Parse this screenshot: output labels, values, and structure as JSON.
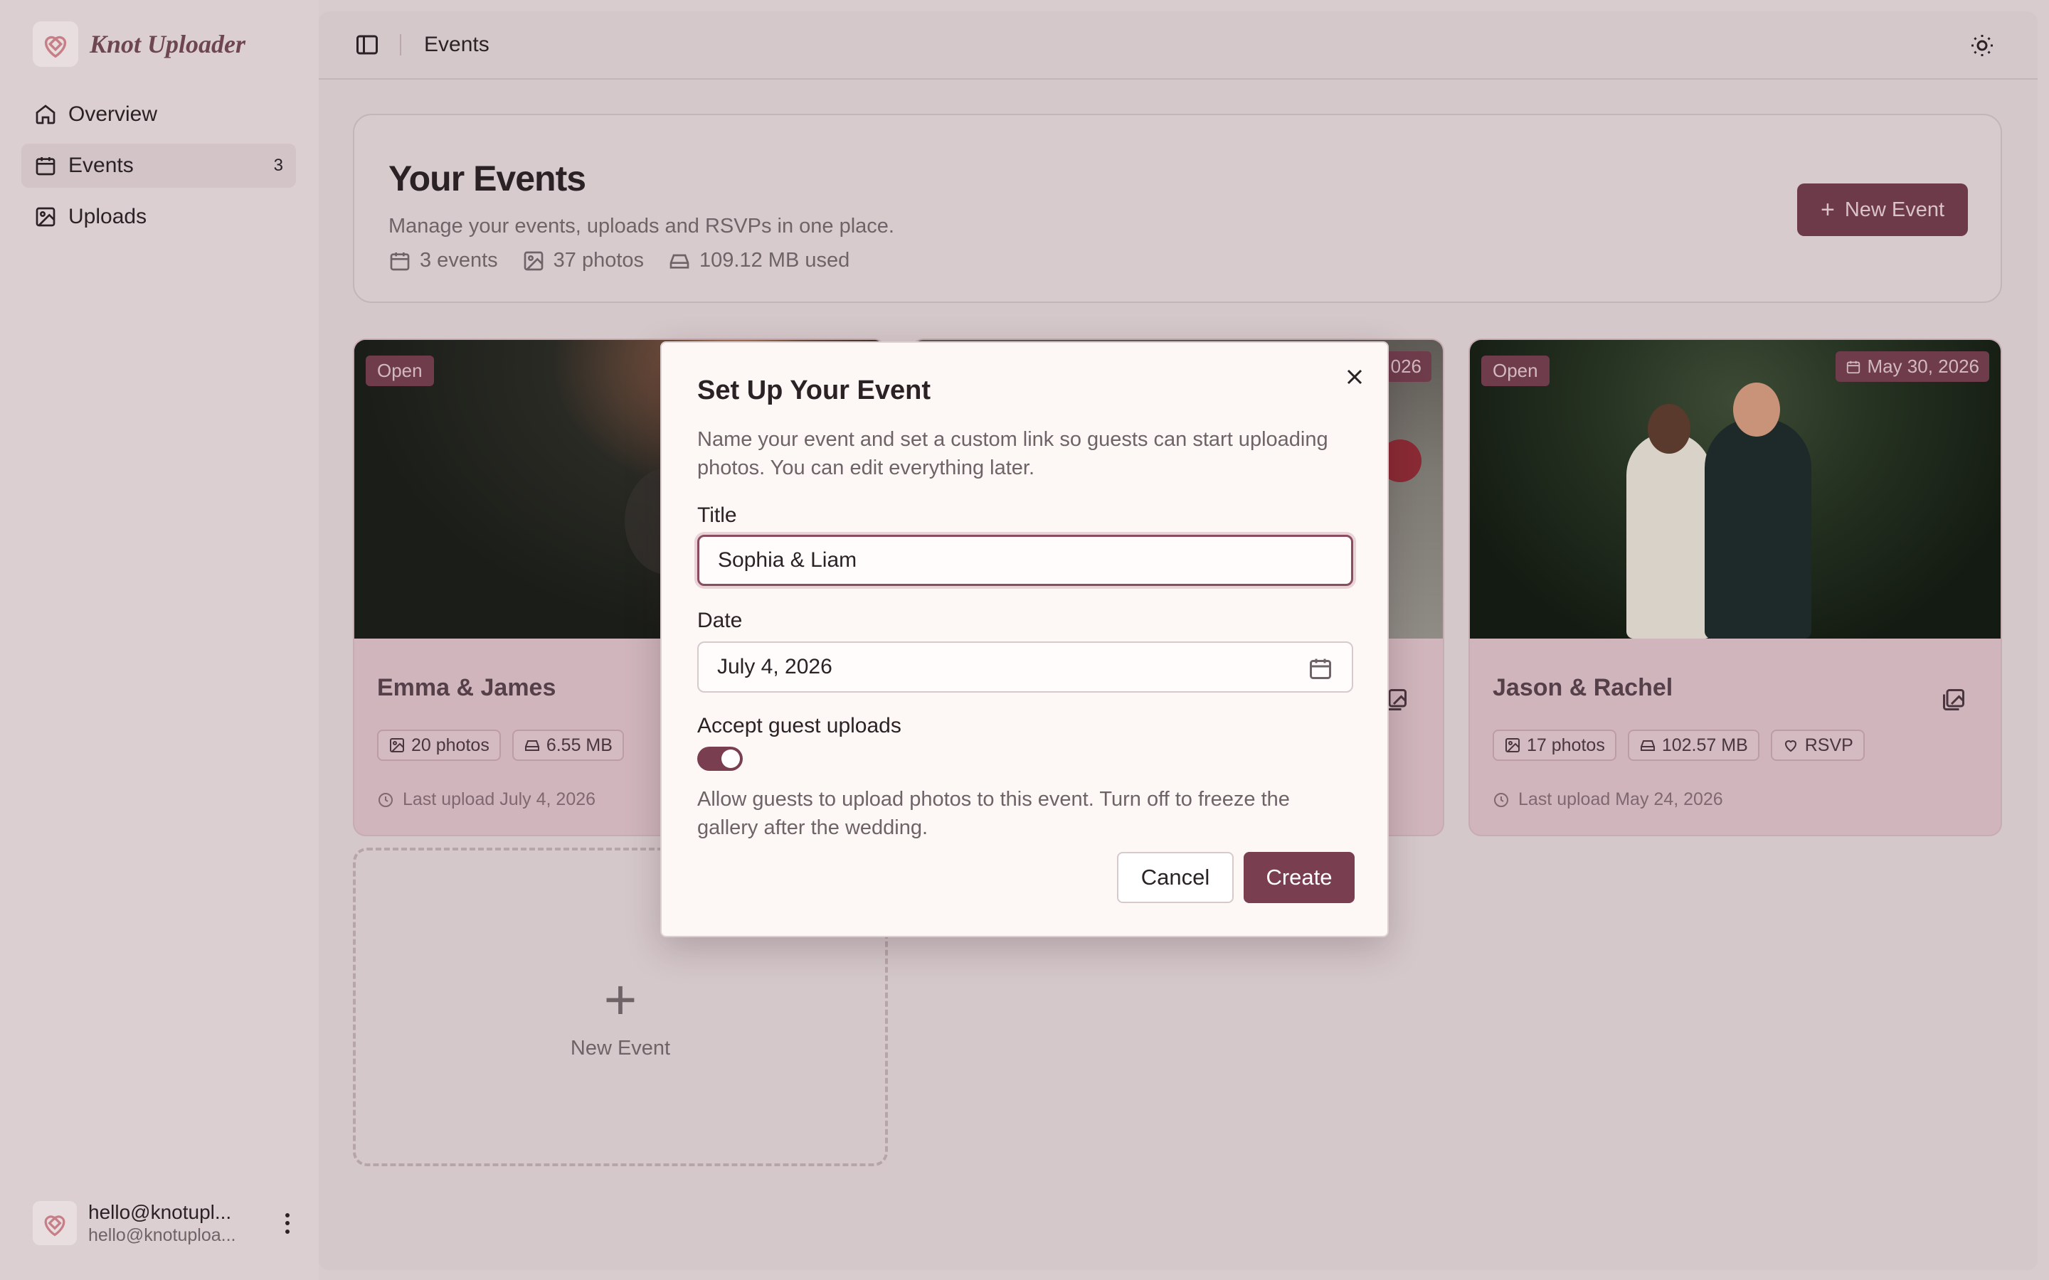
{
  "app": {
    "name": "Knot Uploader",
    "logo_icon": "knot-heart-logo-icon"
  },
  "sidebar": {
    "items": [
      {
        "label": "Overview",
        "icon": "home-icon",
        "count": ""
      },
      {
        "label": "Events",
        "icon": "calendar-icon",
        "count": "3"
      },
      {
        "label": "Uploads",
        "icon": "image-icon",
        "count": ""
      }
    ],
    "active_item": "Events",
    "user": {
      "name": "hello@knotupl...",
      "email": "hello@knotuploa..."
    }
  },
  "header": {
    "breadcrumb": "Events",
    "theme_icon": "sun-icon",
    "sidebar_toggle_icon": "panel-left-icon"
  },
  "summary": {
    "title": "Your Events",
    "subtitle": "Manage your events, uploads and RSVPs in one place.",
    "stats": {
      "events": "3 events",
      "photos": "37 photos",
      "storage": "109.12 MB used"
    },
    "new_event_label": "New Event"
  },
  "events": [
    {
      "title": "Emma & James",
      "status": "Open",
      "photos": "20 photos",
      "size": "6.55 MB",
      "last_upload": "Last upload July 4, 2026"
    },
    {
      "date_badge_partial": "026"
    },
    {
      "title": "Jason & Rachel",
      "status": "Open",
      "date": "May 30, 2026",
      "photos": "17 photos",
      "size": "102.57 MB",
      "rsvp": "RSVP",
      "last_upload": "Last upload May 24, 2026"
    }
  ],
  "new_event_card": {
    "label": "New Event"
  },
  "modal": {
    "title": "Set Up Your Event",
    "description": "Name your event and set a custom link so guests can start uploading photos. You can edit everything later.",
    "title_label": "Title",
    "title_value": "Sophia & Liam",
    "date_label": "Date",
    "date_value": "July 4, 2026",
    "uploads_label": "Accept guest uploads",
    "uploads_enabled": true,
    "uploads_hint": "Allow guests to upload photos to this event. Turn off to freeze the gallery after the wedding.",
    "cancel_label": "Cancel",
    "create_label": "Create"
  },
  "colors": {
    "accent": "#7a3e51",
    "badge": "#6f3c4c",
    "background": "#d9ccce",
    "modal_bg": "#fdf7f6"
  }
}
